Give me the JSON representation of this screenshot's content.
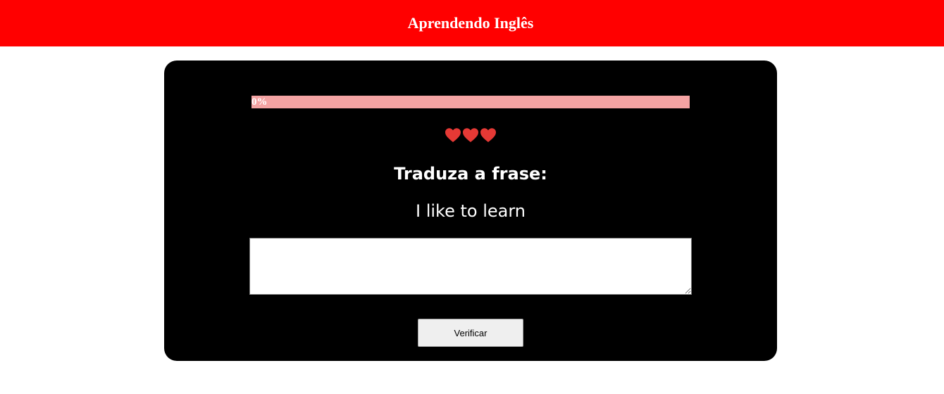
{
  "header": {
    "title": "Aprendendo Inglês"
  },
  "progress": {
    "value_percent": 0,
    "label": "0%"
  },
  "lives": {
    "count": 3,
    "icon": "heart-icon",
    "color": "#e53935"
  },
  "exercise": {
    "instruction": "Traduza a frase:",
    "phrase": "I like to learn",
    "answer_value": ""
  },
  "actions": {
    "verify_label": "Verificar"
  },
  "colors": {
    "header_bg": "#ff0000",
    "card_bg": "#000000",
    "progress_track": "#f4a3a3"
  }
}
